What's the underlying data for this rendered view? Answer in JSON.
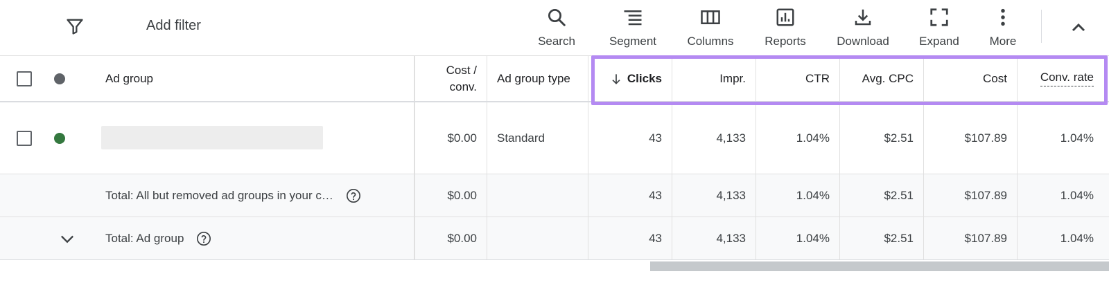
{
  "toolbar": {
    "add_filter_label": "Add filter",
    "tools": [
      {
        "label": "Search",
        "icon": "search-icon"
      },
      {
        "label": "Segment",
        "icon": "segment-icon"
      },
      {
        "label": "Columns",
        "icon": "columns-icon"
      },
      {
        "label": "Reports",
        "icon": "reports-icon"
      },
      {
        "label": "Download",
        "icon": "download-icon"
      },
      {
        "label": "Expand",
        "icon": "expand-icon"
      },
      {
        "label": "More",
        "icon": "more-vert-icon"
      }
    ]
  },
  "table": {
    "headers": {
      "ad_group": "Ad group",
      "cost_conv_line1": "Cost /",
      "cost_conv_line2": "conv.",
      "ad_group_type": "Ad group type",
      "clicks": "Clicks",
      "impr": "Impr.",
      "ctr": "CTR",
      "avg_cpc": "Avg. CPC",
      "cost": "Cost",
      "conv_rate": "Conv. rate"
    },
    "rows": [
      {
        "name": "",
        "cost_conv": "$0.00",
        "type": "Standard",
        "clicks": "43",
        "impr": "4,133",
        "ctr": "1.04%",
        "avg_cpc": "$2.51",
        "cost": "$107.89",
        "conv_rate": "1.04%"
      },
      {
        "name": "Total: All but removed ad groups in your c…",
        "cost_conv": "$0.00",
        "type": "",
        "clicks": "43",
        "impr": "4,133",
        "ctr": "1.04%",
        "avg_cpc": "$2.51",
        "cost": "$107.89",
        "conv_rate": "1.04%"
      },
      {
        "name": "Total: Ad group",
        "cost_conv": "$0.00",
        "type": "",
        "clicks": "43",
        "impr": "4,133",
        "ctr": "1.04%",
        "avg_cpc": "$2.51",
        "cost": "$107.89",
        "conv_rate": "1.04%"
      }
    ]
  },
  "colors": {
    "highlight": "#b48af2",
    "status_enabled": "#34783f",
    "status_header": "#5f6368"
  }
}
